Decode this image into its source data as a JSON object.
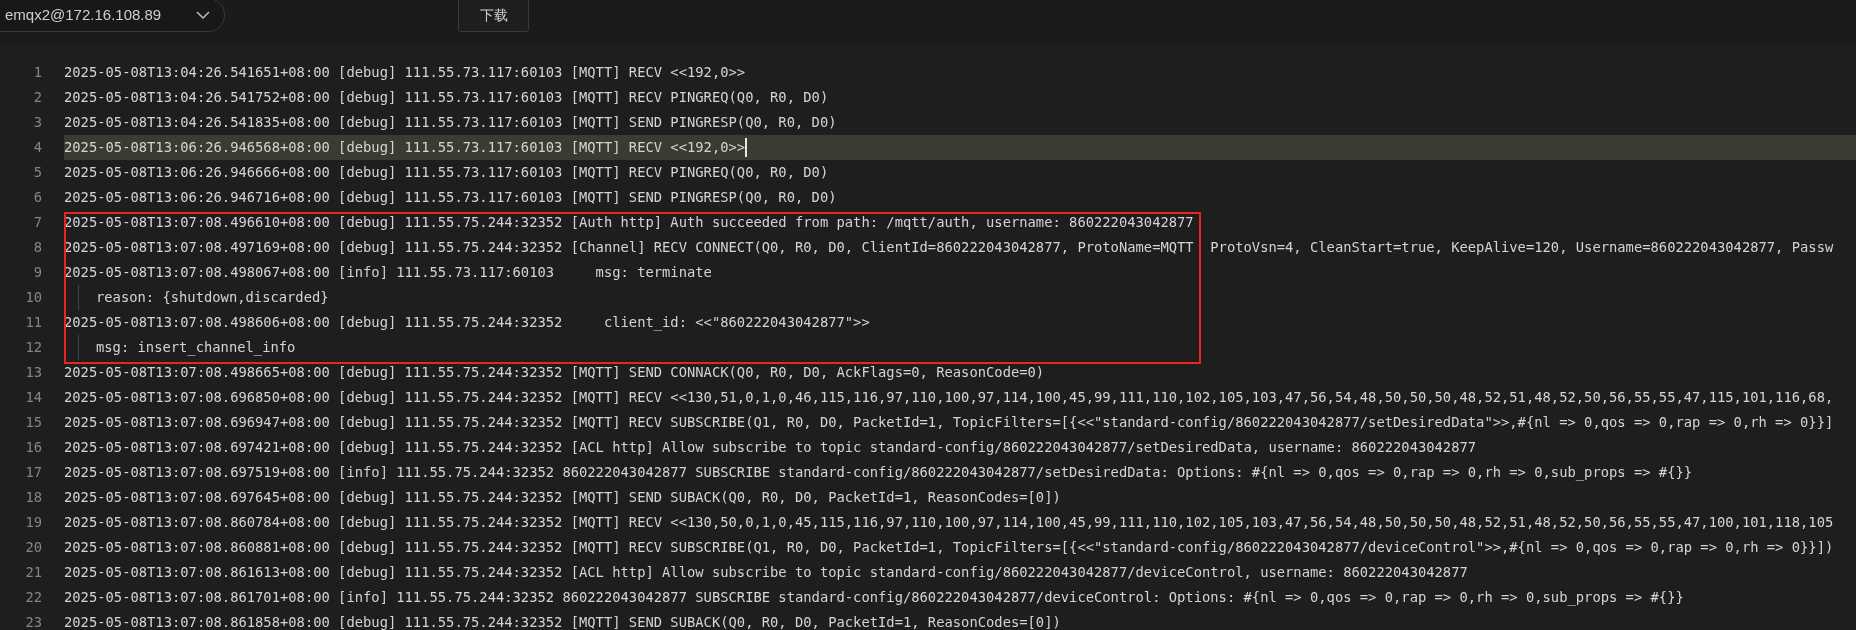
{
  "toolbar": {
    "node_select": {
      "value": "emqx2@172.16.108.89"
    },
    "download_button": "下载"
  },
  "log_lines": [
    {
      "number": "1",
      "kind": "entry",
      "current": false,
      "boxed": false,
      "text": "2025-05-08T13:04:26.541651+08:00 [debug] 111.55.73.117:60103 [MQTT] RECV <<192,0>>"
    },
    {
      "number": "2",
      "kind": "entry",
      "current": false,
      "boxed": false,
      "text": "2025-05-08T13:04:26.541752+08:00 [debug] 111.55.73.117:60103 [MQTT] RECV PINGREQ(Q0, R0, D0)"
    },
    {
      "number": "3",
      "kind": "entry",
      "current": false,
      "boxed": false,
      "text": "2025-05-08T13:04:26.541835+08:00 [debug] 111.55.73.117:60103 [MQTT] SEND PINGRESP(Q0, R0, D0)"
    },
    {
      "number": "4",
      "kind": "entry",
      "current": true,
      "boxed": false,
      "text": "2025-05-08T13:06:26.946568+08:00 [debug] 111.55.73.117:60103 [MQTT] RECV <<192,0>>"
    },
    {
      "number": "5",
      "kind": "entry",
      "current": false,
      "boxed": false,
      "text": "2025-05-08T13:06:26.946666+08:00 [debug] 111.55.73.117:60103 [MQTT] RECV PINGREQ(Q0, R0, D0)"
    },
    {
      "number": "6",
      "kind": "entry",
      "current": false,
      "boxed": false,
      "text": "2025-05-08T13:06:26.946716+08:00 [debug] 111.55.73.117:60103 [MQTT] SEND PINGRESP(Q0, R0, D0)"
    },
    {
      "number": "7",
      "kind": "entry",
      "current": false,
      "boxed": true,
      "text": "2025-05-08T13:07:08.496610+08:00 [debug] 111.55.75.244:32352 [Auth http] Auth succeeded from path: /mqtt/auth, username: 860222043042877"
    },
    {
      "number": "8",
      "kind": "entry",
      "current": false,
      "boxed": true,
      "text": "2025-05-08T13:07:08.497169+08:00 [debug] 111.55.75.244:32352 [Channel] RECV CONNECT(Q0, R0, D0, ClientId=860222043042877, ProtoName=MQTT  ProtoVsn=4, CleanStart=true, KeepAlive=120, Username=860222043042877, Passw"
    },
    {
      "number": "9",
      "kind": "entry",
      "current": false,
      "boxed": true,
      "text": "2025-05-08T13:07:08.498067+08:00 [info] 111.55.73.117:60103     msg: terminate"
    },
    {
      "number": "10",
      "kind": "continuation",
      "current": false,
      "boxed": true,
      "text": "reason: {shutdown,discarded}"
    },
    {
      "number": "11",
      "kind": "entry",
      "current": false,
      "boxed": true,
      "text": "2025-05-08T13:07:08.498606+08:00 [debug] 111.55.75.244:32352     client_id: <<\"860222043042877\">>"
    },
    {
      "number": "12",
      "kind": "continuation",
      "current": false,
      "boxed": true,
      "text": "msg: insert_channel_info"
    },
    {
      "number": "13",
      "kind": "entry",
      "current": false,
      "boxed": false,
      "text": "2025-05-08T13:07:08.498665+08:00 [debug] 111.55.75.244:32352 [MQTT] SEND CONNACK(Q0, R0, D0, AckFlags=0, ReasonCode=0)"
    },
    {
      "number": "14",
      "kind": "entry",
      "current": false,
      "boxed": false,
      "text": "2025-05-08T13:07:08.696850+08:00 [debug] 111.55.75.244:32352 [MQTT] RECV <<130,51,0,1,0,46,115,116,97,110,100,97,114,100,45,99,111,110,102,105,103,47,56,54,48,50,50,50,48,52,51,48,52,50,56,55,55,47,115,101,116,68,"
    },
    {
      "number": "15",
      "kind": "entry",
      "current": false,
      "boxed": false,
      "text": "2025-05-08T13:07:08.696947+08:00 [debug] 111.55.75.244:32352 [MQTT] RECV SUBSCRIBE(Q1, R0, D0, PacketId=1, TopicFilters=[{<<\"standard-config/860222043042877/setDesiredData\">>,#{nl => 0,qos => 0,rap => 0,rh => 0}}]"
    },
    {
      "number": "16",
      "kind": "entry",
      "current": false,
      "boxed": false,
      "text": "2025-05-08T13:07:08.697421+08:00 [debug] 111.55.75.244:32352 [ACL http] Allow subscribe to topic standard-config/860222043042877/setDesiredData, username: 860222043042877"
    },
    {
      "number": "17",
      "kind": "entry",
      "current": false,
      "boxed": false,
      "text": "2025-05-08T13:07:08.697519+08:00 [info] 111.55.75.244:32352 860222043042877 SUBSCRIBE standard-config/860222043042877/setDesiredData: Options: #{nl => 0,qos => 0,rap => 0,rh => 0,sub_props => #{}}"
    },
    {
      "number": "18",
      "kind": "entry",
      "current": false,
      "boxed": false,
      "text": "2025-05-08T13:07:08.697645+08:00 [debug] 111.55.75.244:32352 [MQTT] SEND SUBACK(Q0, R0, D0, PacketId=1, ReasonCodes=[0])"
    },
    {
      "number": "19",
      "kind": "entry",
      "current": false,
      "boxed": false,
      "text": "2025-05-08T13:07:08.860784+08:00 [debug] 111.55.75.244:32352 [MQTT] RECV <<130,50,0,1,0,45,115,116,97,110,100,97,114,100,45,99,111,110,102,105,103,47,56,54,48,50,50,50,48,52,51,48,52,50,56,55,55,47,100,101,118,105"
    },
    {
      "number": "20",
      "kind": "entry",
      "current": false,
      "boxed": false,
      "text": "2025-05-08T13:07:08.860881+08:00 [debug] 111.55.75.244:32352 [MQTT] RECV SUBSCRIBE(Q1, R0, D0, PacketId=1, TopicFilters=[{<<\"standard-config/860222043042877/deviceControl\">>,#{nl => 0,qos => 0,rap => 0,rh => 0}}])"
    },
    {
      "number": "21",
      "kind": "entry",
      "current": false,
      "boxed": false,
      "text": "2025-05-08T13:07:08.861613+08:00 [debug] 111.55.75.244:32352 [ACL http] Allow subscribe to topic standard-config/860222043042877/deviceControl, username: 860222043042877"
    },
    {
      "number": "22",
      "kind": "entry",
      "current": false,
      "boxed": false,
      "text": "2025-05-08T13:07:08.861701+08:00 [info] 111.55.75.244:32352 860222043042877 SUBSCRIBE standard-config/860222043042877/deviceControl: Options: #{nl => 0,qos => 0,rap => 0,rh => 0,sub_props => #{}}"
    },
    {
      "number": "23",
      "kind": "entry",
      "current": false,
      "boxed": false,
      "text": "2025-05-08T13:07:08.861858+08:00 [debug] 111.55.75.244:32352 [MQTT] SEND SUBACK(Q0, R0, D0, PacketId=1, ReasonCodes=[0])"
    }
  ]
}
